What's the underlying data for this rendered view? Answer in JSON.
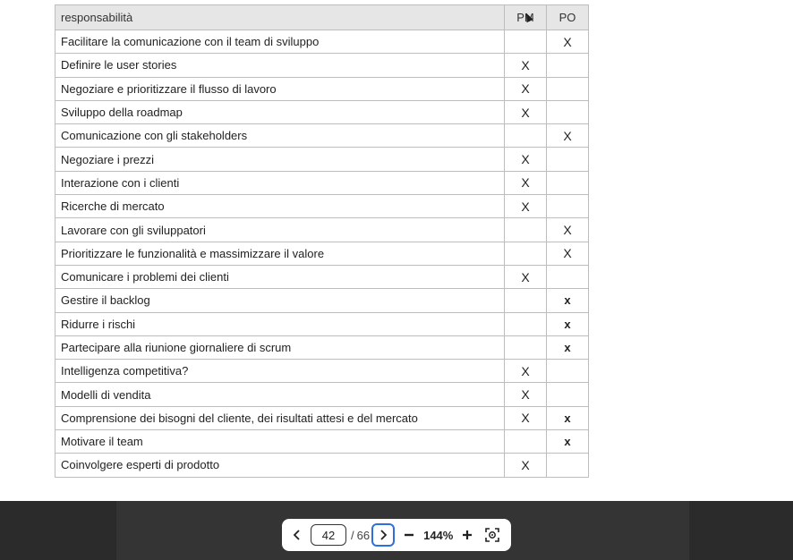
{
  "table": {
    "headers": {
      "task": "responsabilità",
      "pm": "PM",
      "po": "PO"
    },
    "rows": [
      {
        "task": "Facilitare la comunicazione con il team di sviluppo",
        "pm": "",
        "po": "X"
      },
      {
        "task": "Definire le user stories",
        "pm": "X",
        "po": ""
      },
      {
        "task": "Negoziare e prioritizzare il flusso di lavoro",
        "pm": "X",
        "po": ""
      },
      {
        "task": "Sviluppo della roadmap",
        "pm": "X",
        "po": ""
      },
      {
        "task": "Comunicazione con gli stakeholders",
        "pm": "",
        "po": "X"
      },
      {
        "task": "Negoziare i prezzi",
        "pm": "X",
        "po": ""
      },
      {
        "task": "Interazione con i clienti",
        "pm": "X",
        "po": ""
      },
      {
        "task": "Ricerche di mercato",
        "pm": "X",
        "po": ""
      },
      {
        "task": "Lavorare con gli sviluppatori",
        "pm": "",
        "po": "X"
      },
      {
        "task": "Prioritizzare le funzionalità e massimizzare il valore",
        "pm": "",
        "po": "X"
      },
      {
        "task": "Comunicare i problemi dei clienti",
        "pm": "X",
        "po": ""
      },
      {
        "task": "Gestire il backlog",
        "pm": "",
        "po": "x"
      },
      {
        "task": "Ridurre i rischi",
        "pm": "",
        "po": "x"
      },
      {
        "task": "Partecipare alla riunione giornaliere di scrum",
        "pm": "",
        "po": "x"
      },
      {
        "task": "Intelligenza competitiva?",
        "pm": "X",
        "po": ""
      },
      {
        "task": "Modelli di vendita",
        "pm": "X",
        "po": ""
      },
      {
        "task": "Comprensione dei bisogni del cliente, dei risultati attesi e del mercato",
        "pm": "X",
        "po": "x"
      },
      {
        "task": "Motivare il team",
        "pm": "",
        "po": "x"
      },
      {
        "task": "Coinvolgere esperti di prodotto",
        "pm": "X",
        "po": ""
      }
    ]
  },
  "viewer": {
    "prev_icon": "chevron-left-icon",
    "next_icon": "chevron-right-icon",
    "current_page": "42",
    "separator": "/",
    "total_pages": "66",
    "zoom_out_icon": "minus-icon",
    "zoom_level": "144%",
    "zoom_in_icon": "plus-icon",
    "fit_icon": "fit-to-screen-icon"
  }
}
